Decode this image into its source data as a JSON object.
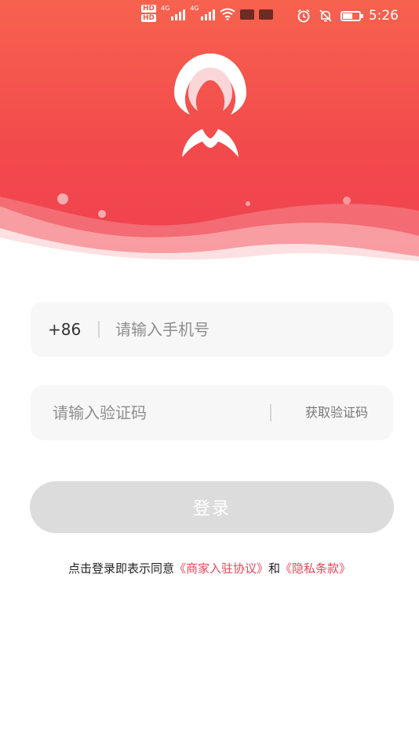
{
  "status_bar": {
    "hd_1": "HD",
    "hd_2": "HD",
    "network": "4G",
    "time": "5:26",
    "icons": [
      "hd-icon",
      "signal-icon",
      "wifi-icon",
      "alarm-icon",
      "mute-icon",
      "battery-icon"
    ]
  },
  "colors": {
    "header_top": "#f7624e",
    "header_bottom": "#ef4150",
    "link": "#e8465a",
    "button_disabled": "#dcdcdc",
    "field_bg": "#f7f7f7"
  },
  "phone": {
    "prefix": "+86",
    "placeholder": "请输入手机号"
  },
  "code": {
    "placeholder": "请输入验证码",
    "get_code_label": "获取验证码"
  },
  "login": {
    "label": "登录"
  },
  "agreement": {
    "prefix": "点击登录即表示同意",
    "link_merchant": "《商家入驻协议》",
    "conjunction": "和",
    "link_privacy": "《隐私条款》"
  }
}
